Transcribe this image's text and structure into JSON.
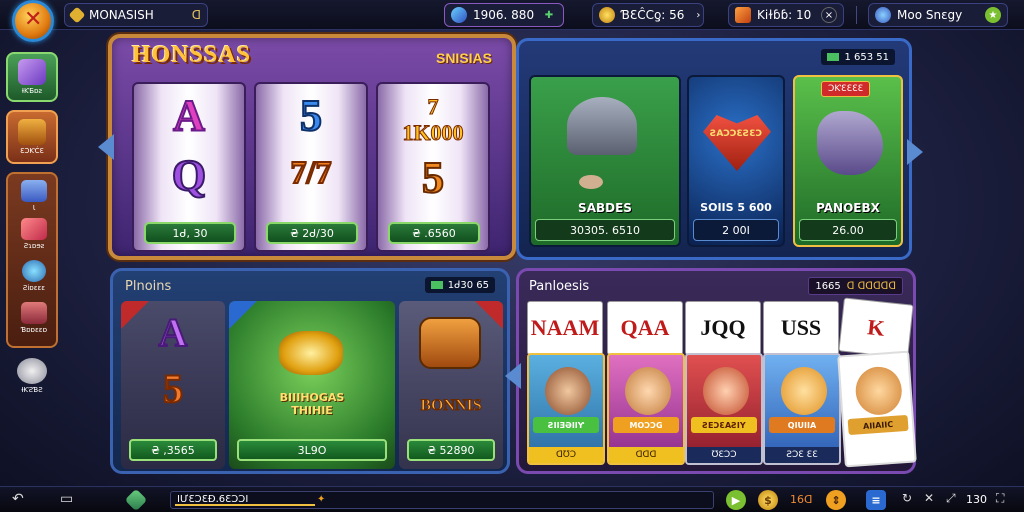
{
  "topbar": {
    "player_name": "MONASISH",
    "player_badge": "ᗡ",
    "balance_1": "1906. 880",
    "balance_2": "ƁƐĈCƍ: 56",
    "balance_3": "Kiɫɓɓ: 10",
    "social": "Moo Snɛgy"
  },
  "sidebar": {
    "items": [
      {
        "label": "ƗƘƂɒƨ"
      },
      {
        "label": "ƐƆƘĊƐ"
      },
      {
        "label": "Ɩ"
      },
      {
        "label": "Ƨɿɒɘƨ"
      },
      {
        "label": "Ƨiɒɛɛɛ"
      },
      {
        "label": "Ɓɒɒɛɛɒ"
      },
      {
        "label": "ƗƘƧƁƧ"
      }
    ]
  },
  "slots": {
    "title": "HONSSAS",
    "subtitle": "SNISIAS",
    "reels": [
      {
        "top": "A",
        "bottom": "Q",
        "bet": "1ᑯ, 30"
      },
      {
        "top": "5",
        "bottom": "7/7",
        "bet": "₴ 2ᑯ/30"
      },
      {
        "top": "7\n1K000",
        "bottom": "5",
        "bet": "₴ .6560"
      }
    ]
  },
  "games": {
    "counter": "1 653 51",
    "cards": [
      {
        "title": "SABDES",
        "foot": "30305. 6510"
      },
      {
        "title": "SOIIS 5 600",
        "art": "ƧAƆƆƐƧƐƆ",
        "foot": "2 00I"
      },
      {
        "title": "PANOEBX",
        "badge": "ƆƘƐƐƐƐ",
        "foot": "26.00"
      }
    ]
  },
  "bonus": {
    "title": "Plnoins",
    "counter": "1ᑯ30 65",
    "cards": [
      {
        "art_top": "A",
        "art_bottom": "5",
        "foot": "₴ ,3565"
      },
      {
        "art": "BIIIHOGAS\nTHIHIE",
        "foot": "3L9O"
      },
      {
        "art": "BONNIS",
        "foot": "₴ 52890"
      }
    ]
  },
  "poker": {
    "title": "Panloesis",
    "counter": "1665",
    "counter_2": "ᗡ ᗡᗡᗡᗡᗡ",
    "cards": [
      "NAAM",
      "QAA",
      "JQQ",
      "USS",
      "K"
    ],
    "heroes": [
      {
        "tag": "ƧIIƎƏIIƳ",
        "foot": "ᗡƱƆ"
      },
      {
        "tag": "MOƆƆG",
        "foot": "ᗡᗡᗡ"
      },
      {
        "tag": "ƧEƆƐAƧIY",
        "foot": "ƱƐƆƆ"
      },
      {
        "tag": "QIUIIA",
        "foot": "ƧƆƐ ƐƐ"
      },
      {
        "tag": "AIIAIIC",
        "foot": ""
      }
    ]
  },
  "bottombar": {
    "ticker": "IƯƐƆƐƉ.6ƐƆƆI",
    "count_1": "16ᗡ",
    "count_2": "130"
  },
  "colors": {
    "gold": "#ffc23a",
    "green_button": "#2a7a3a",
    "purple_panel": "#7b4ba8",
    "blue_panel": "#233a78"
  }
}
